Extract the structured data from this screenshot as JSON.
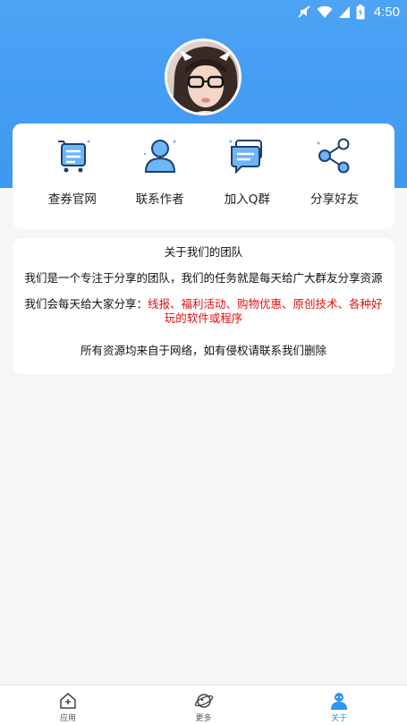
{
  "status_bar": {
    "time": "4:50"
  },
  "menu": [
    {
      "label": "查券官网",
      "icon": "cart-icon"
    },
    {
      "label": "联系作者",
      "icon": "user-icon"
    },
    {
      "label": "加入Q群",
      "icon": "chat-icon"
    },
    {
      "label": "分享好友",
      "icon": "share-icon"
    }
  ],
  "about": {
    "title": "关于我们的团队",
    "paragraph1": "我们是一个专注于分享的团队，我们的任务就是每天给广大群友分享资源",
    "paragraph2_prefix": "我们会每天给大家分享：",
    "paragraph2_highlight": "线报、福利活动、购物优惠、原创技术、各种好玩的软件或程序",
    "paragraph3": "所有资源均来自于网络，如有侵权请联系我们删除"
  },
  "tabs": [
    {
      "label": "应用",
      "icon": "home-icon",
      "active": false
    },
    {
      "label": "更多",
      "icon": "planet-icon",
      "active": false
    },
    {
      "label": "关于",
      "icon": "profile-icon",
      "active": true
    }
  ],
  "colors": {
    "accent": "#3c98f0",
    "highlight": "#e01010"
  }
}
